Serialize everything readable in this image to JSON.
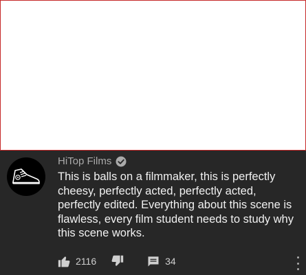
{
  "comment": {
    "author": "HiTop Films",
    "verified": true,
    "avatar": "sneaker-logo",
    "text": "This is balls on a filmmaker, this is perfectly cheesy, perfectly acted, perfectly acted, perfectly edited. Everything about this scene is flawless, every film student needs to study why this scene works.",
    "like_count": "2116",
    "reply_count": "34"
  },
  "icons": {
    "like": "thumbs-up-icon",
    "dislike": "thumbs-down-icon",
    "reply": "comment-icon",
    "more": "more-vertical-icon",
    "verified": "checkmark-circle-icon"
  },
  "colors": {
    "panel_bg": "#272727",
    "text": "#f1f1f1",
    "secondary_text": "#aaaaaa",
    "frame_border": "#c62828"
  }
}
